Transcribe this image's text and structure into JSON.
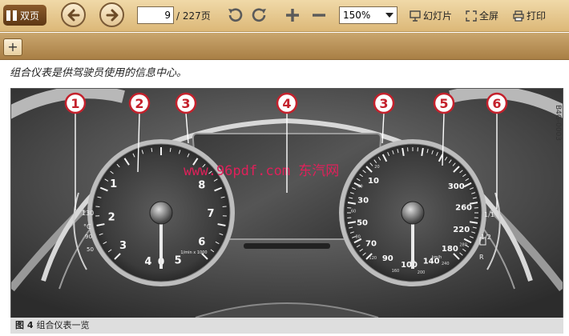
{
  "toolbar": {
    "double_page_label": "双页",
    "current_page": "9",
    "page_total": "/ 227页",
    "zoom": "150%",
    "slideshow_label": "幻灯片",
    "fullscreen_label": "全屏",
    "print_label": "打印"
  },
  "tabs": {
    "add_label": "+"
  },
  "document": {
    "intro_text": "组合仪表是供驾驶员使用的信息中心。",
    "figure": {
      "code": "B4G-0003",
      "watermark": "www.96pdf.com 东汽网",
      "callouts": [
        "1",
        "2",
        "3",
        "4",
        "3",
        "5",
        "6"
      ],
      "caption_number": "图 4",
      "caption_text": "组合仪表一览"
    }
  },
  "gauges": {
    "temp": {
      "top": "130",
      "symbol": "°C",
      "mid": "90",
      "low": "50"
    },
    "tachometer": {
      "ticks": [
        "1",
        "2",
        "3",
        "4",
        "5",
        "6",
        "7",
        "8",
        "0"
      ],
      "unit": "1/min x 1000"
    },
    "speedometer": {
      "ticks": [
        "10",
        "30",
        "50",
        "70",
        "90",
        "100",
        "140",
        "180",
        "220",
        "260",
        "300",
        "0",
        "20",
        "40",
        "60",
        "80",
        "120",
        "160",
        "200",
        "240",
        "280"
      ],
      "unit": "km/h"
    },
    "fuel": {
      "full": "1/1",
      "half": "1/2",
      "reserve": "R"
    }
  },
  "colors": {
    "toolbar": "#e6c68c",
    "tabstrip": "#b88d52",
    "callout": "#c4212c",
    "watermark": "#e0205a"
  }
}
